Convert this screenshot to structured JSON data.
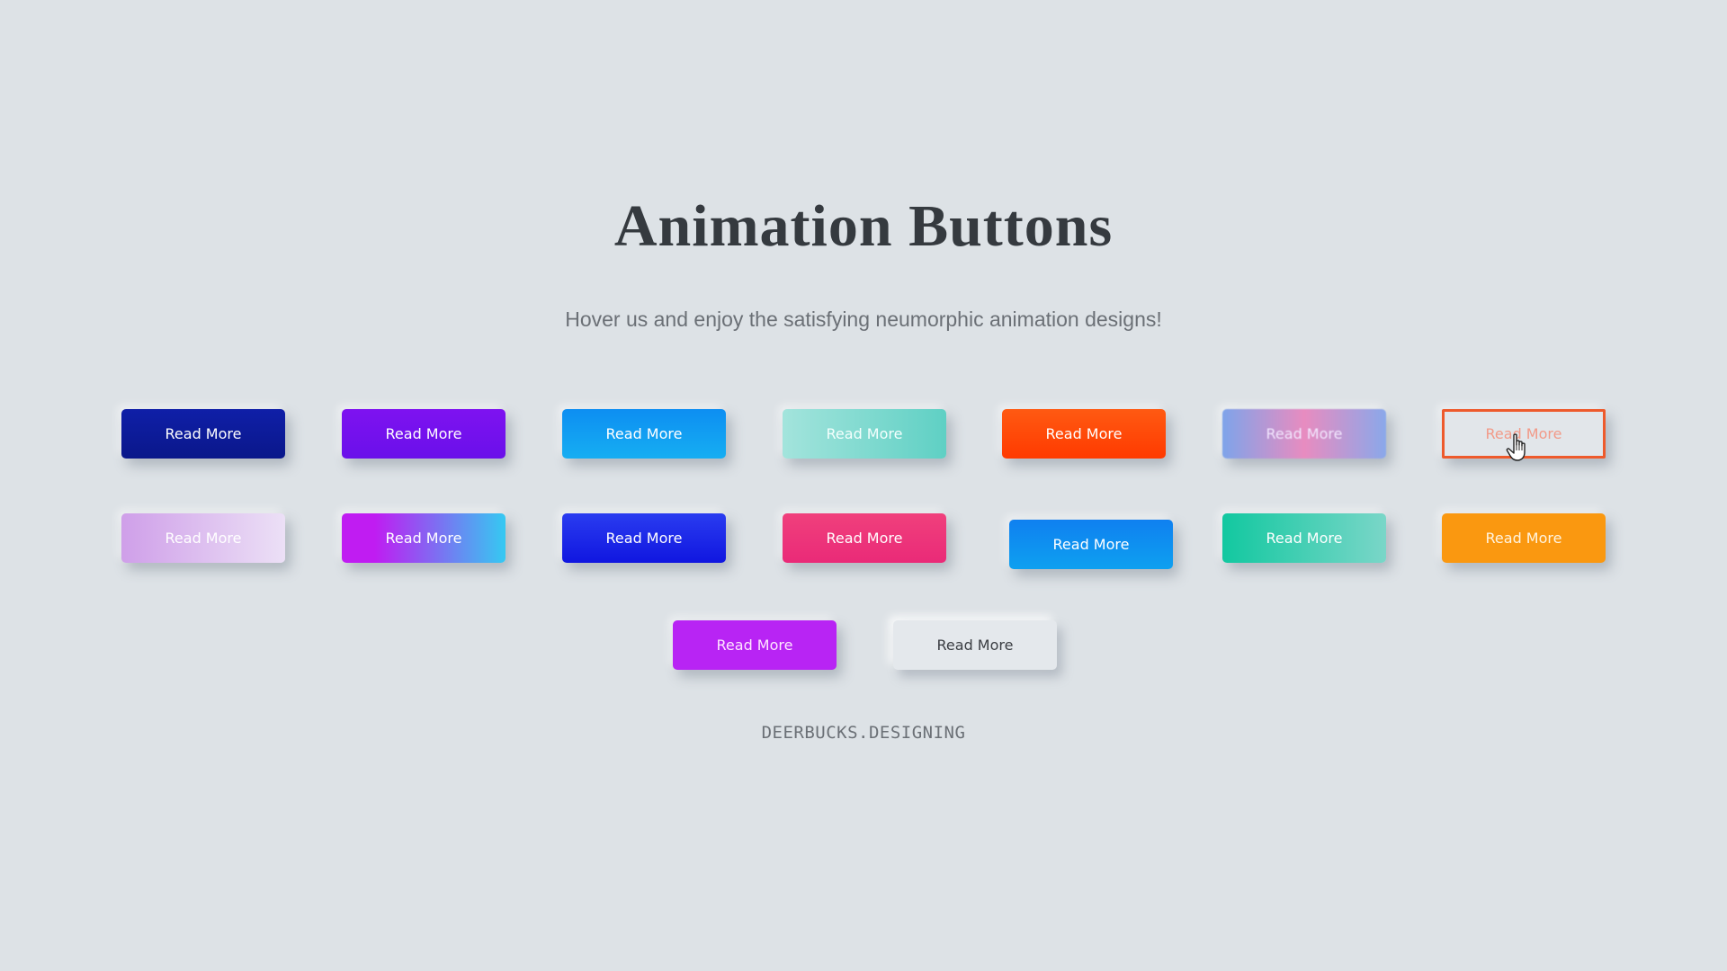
{
  "page": {
    "title": "Animation Buttons",
    "subtitle": "Hover us and enjoy the satisfying neumorphic animation designs!",
    "footer": "DEERBUCKS.DESIGNING"
  },
  "buttons": [
    {
      "label": "Read More",
      "row": 1,
      "col": 1,
      "style": "navy",
      "background": "linear-gradient(180deg,#0f1fa8,#0a178a)",
      "text_color": "#ffffff",
      "state": "normal"
    },
    {
      "label": "Read More",
      "row": 1,
      "col": 2,
      "style": "violet",
      "background": "linear-gradient(180deg,#7e12f0,#6a10ea)",
      "text_color": "#ffffff",
      "state": "normal"
    },
    {
      "label": "Read More",
      "row": 1,
      "col": 3,
      "style": "sky-blue",
      "background": "linear-gradient(180deg,#0d8ef2,#16aef2)",
      "text_color": "#ffffff",
      "state": "normal"
    },
    {
      "label": "Read More",
      "row": 1,
      "col": 4,
      "style": "mint",
      "background": "linear-gradient(90deg,#a3e4dc,#5fd0c4)",
      "text_color": "#f4fffd",
      "state": "normal"
    },
    {
      "label": "Read More",
      "row": 1,
      "col": 5,
      "style": "red-orange",
      "background": "linear-gradient(180deg,#ff5a12,#ff3a00)",
      "text_color": "#ffffff",
      "state": "normal"
    },
    {
      "label": "Read More",
      "row": 1,
      "col": 6,
      "style": "blue-pink-blur",
      "background": "linear-gradient(90deg,#7ea4ea,#e88cc0 50%,#8aa8ea)",
      "text_color": "#f3e8ff",
      "state": "animating"
    },
    {
      "label": "Read More",
      "row": 1,
      "col": 7,
      "style": "outline-orange",
      "background": "#e2e6ea",
      "text_color": "#f29a88",
      "border_color": "#ee5a2c",
      "state": "hovered"
    },
    {
      "label": "Read More",
      "row": 2,
      "col": 1,
      "style": "lilac",
      "background": "linear-gradient(90deg,#cf9fe9,#ece0f6)",
      "text_color": "#ffffff",
      "state": "normal"
    },
    {
      "label": "Read More",
      "row": 2,
      "col": 2,
      "style": "magenta-cyan",
      "background": "linear-gradient(90deg,#c01cf2 20%,#35c9f2)",
      "text_color": "#ffffff",
      "state": "normal"
    },
    {
      "label": "Read More",
      "row": 2,
      "col": 3,
      "style": "royal-blue",
      "background": "linear-gradient(180deg,#2a3cf0,#1016e0)",
      "text_color": "#ffffff",
      "state": "normal"
    },
    {
      "label": "Read More",
      "row": 2,
      "col": 4,
      "style": "pink",
      "background": "linear-gradient(180deg,#f0407c,#ea2a78)",
      "text_color": "#ffffff",
      "state": "normal"
    },
    {
      "label": "Read More",
      "row": 2,
      "col": 5,
      "style": "blue-shifted",
      "background": "linear-gradient(180deg,#0f80f0,#0ea0f0)",
      "text_color": "#ffffff",
      "state": "pressed"
    },
    {
      "label": "Read More",
      "row": 2,
      "col": 6,
      "style": "teal",
      "background": "linear-gradient(90deg,#12c8a0,#7ad6c8)",
      "text_color": "#ffffff",
      "state": "normal"
    },
    {
      "label": "Read More",
      "row": 2,
      "col": 7,
      "style": "amber",
      "background": "#fa9810",
      "text_color": "#fff4e0",
      "state": "normal"
    },
    {
      "label": "Read More",
      "row": 3,
      "col": 1,
      "style": "purple",
      "background": "#b824f4",
      "text_color": "#ffe6ff",
      "state": "normal"
    },
    {
      "label": "Read More",
      "row": 3,
      "col": 2,
      "style": "neumorphic-light",
      "background": "#e4e8ec",
      "text_color": "#3a3d42",
      "state": "normal"
    }
  ],
  "cursor": {
    "type": "hand-pointer-icon",
    "over_button": 7
  }
}
